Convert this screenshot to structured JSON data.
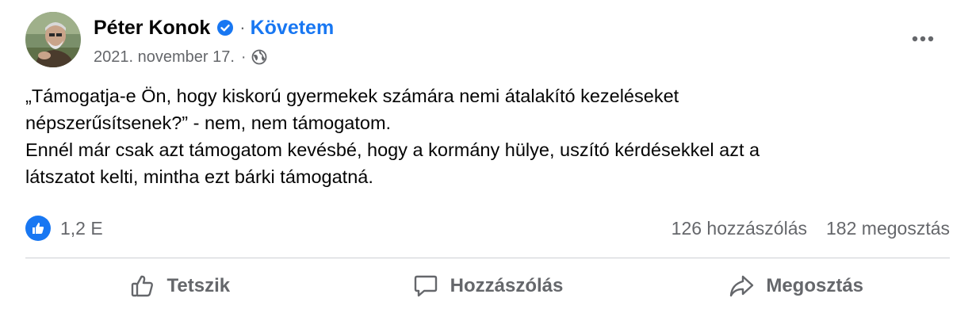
{
  "post": {
    "author": {
      "name": "Péter Konok",
      "follow_label": "Követem",
      "separator": "·",
      "verified_icon": "verified-badge-icon"
    },
    "meta": {
      "date": "2021. november 17.",
      "separator": "·",
      "audience_icon": "globe-icon"
    },
    "more_icon": "more-options-icon",
    "text_lines": [
      "„Támogatja-e Ön, hogy kiskorú gyermekek számára nemi átalakító kezeléseket",
      "népszerűsítsenek?” - nem, nem támogatom.",
      "Ennél már csak azt támogatom kevésbé, hogy a kormány hülye, uszító kérdésekkel azt a",
      "látszatot kelti, mintha ezt bárki támogatná."
    ],
    "stats": {
      "reaction_icon": "like-reaction-icon",
      "reactions": "1,2 E",
      "comments": "126 hozzászólás",
      "shares": "182 megosztás"
    },
    "actions": {
      "like_label": "Tetszik",
      "comment_label": "Hozzászólás",
      "share_label": "Megosztás"
    },
    "colors": {
      "accent": "#1877f2",
      "text_primary": "#050505",
      "text_secondary": "#65676b",
      "divider": "#ced0d4"
    }
  }
}
